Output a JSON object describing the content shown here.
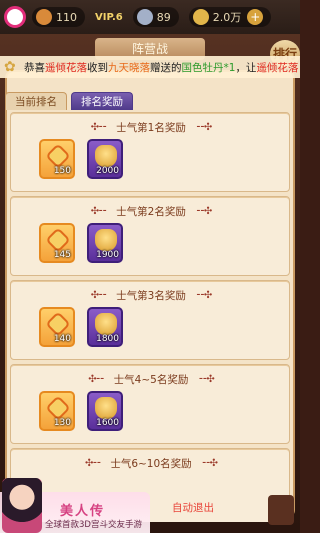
{
  "topbar": {
    "resource_1": "110",
    "vip": "VIP.6",
    "resource_2": "89",
    "resource_3": "2.0万"
  },
  "banner": {
    "title": "阵营战",
    "help": "排行"
  },
  "marquee": {
    "prefix": "恭喜",
    "player1": "遥倾花落",
    "mid1": "收到",
    "player2": "九天晓落",
    "mid2": "赠送的",
    "gift": "国色牡丹*1",
    "mid3": "，让",
    "player3": "遥倾花落"
  },
  "tabs": [
    {
      "label": "当前排名",
      "active": false
    },
    {
      "label": "排名奖励",
      "active": true
    }
  ],
  "rewards": [
    {
      "title": "士气第1名奖励",
      "items": [
        {
          "type": "orange",
          "qty": "150"
        },
        {
          "type": "purple",
          "qty": "2000"
        }
      ]
    },
    {
      "title": "士气第2名奖励",
      "items": [
        {
          "type": "orange",
          "qty": "145"
        },
        {
          "type": "purple",
          "qty": "1900"
        }
      ]
    },
    {
      "title": "士气第3名奖励",
      "items": [
        {
          "type": "orange",
          "qty": "140"
        },
        {
          "type": "purple",
          "qty": "1800"
        }
      ]
    },
    {
      "title": "士气4~5名奖励",
      "items": [
        {
          "type": "orange",
          "qty": "130"
        },
        {
          "type": "purple",
          "qty": "1600"
        }
      ]
    },
    {
      "title": "士气6~10名奖励",
      "items": []
    }
  ],
  "ad": {
    "title": "美人传",
    "subtitle": "全球首款3D宫斗交友手游"
  },
  "exit_label": "自动退出"
}
